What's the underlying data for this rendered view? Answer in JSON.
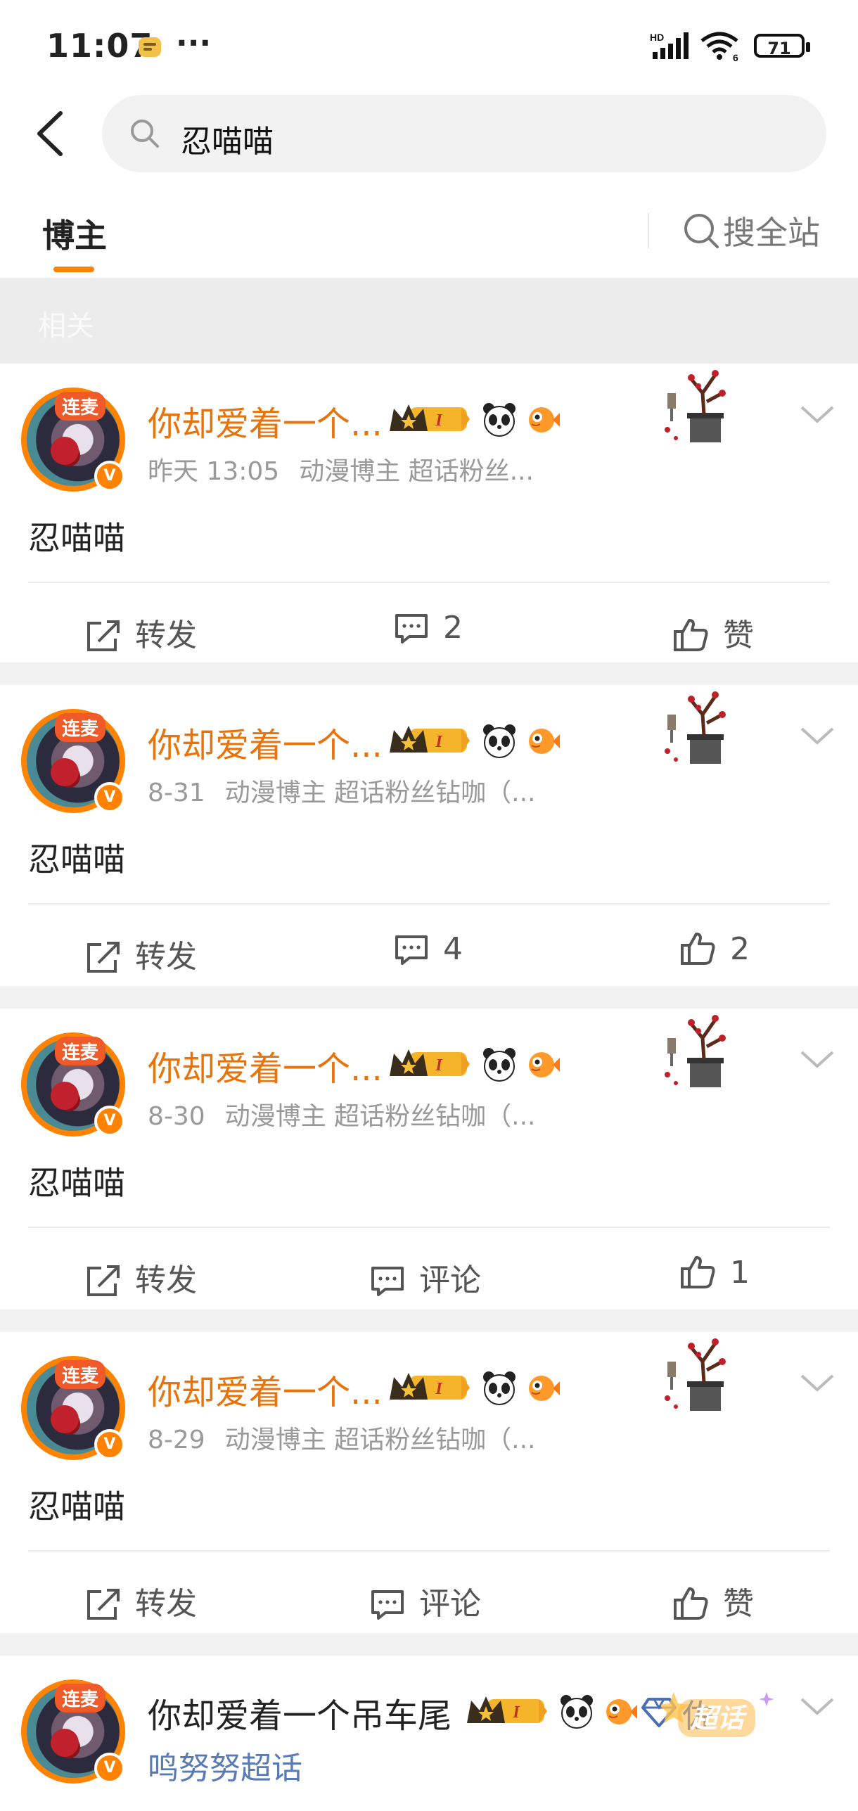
{
  "status": {
    "time": "11:07",
    "more": "···",
    "battery": "71",
    "network": "HD",
    "wifi_label": "6"
  },
  "search": {
    "query": "忍喵喵"
  },
  "tabs": {
    "active": "博主",
    "search_all": "搜全站"
  },
  "filter": {
    "label": "相关"
  },
  "posts": [
    {
      "live_tag": "连麦",
      "verified": "V",
      "nickname": "你却爱着一个...",
      "badge_level": "I",
      "time": "昨天 13:05",
      "desc": "动漫博主 超话粉丝...",
      "content": "忍喵喵",
      "repost": "转发",
      "comment": "2",
      "like": "赞"
    },
    {
      "live_tag": "连麦",
      "verified": "V",
      "nickname": "你却爱着一个...",
      "badge_level": "I",
      "time": "8-31",
      "desc": "动漫博主 超话粉丝钻咖（...",
      "content": "忍喵喵",
      "repost": "转发",
      "comment": "4",
      "like": "2"
    },
    {
      "live_tag": "连麦",
      "verified": "V",
      "nickname": "你却爱着一个...",
      "badge_level": "I",
      "time": "8-30",
      "desc": "动漫博主 超话粉丝钻咖（...",
      "content": "忍喵喵",
      "repost": "转发",
      "comment": "评论",
      "like": "1"
    },
    {
      "live_tag": "连麦",
      "verified": "V",
      "nickname": "你却爱着一个...",
      "badge_level": "I",
      "time": "8-29",
      "desc": "动漫博主 超话粉丝钻咖（...",
      "content": "忍喵喵",
      "repost": "转发",
      "comment": "评论",
      "like": "赞"
    },
    {
      "live_tag": "连麦",
      "verified": "V",
      "nickname": "你却爱着一个吊车尾",
      "badge_level": "I",
      "extra_badge": "佐",
      "super_topic": "鸣努努超话",
      "chaohua_label": "超话"
    }
  ],
  "colors": {
    "accent": "#ff8200",
    "nickname": "#e8730a",
    "supertalk": "#5a7ab5"
  }
}
